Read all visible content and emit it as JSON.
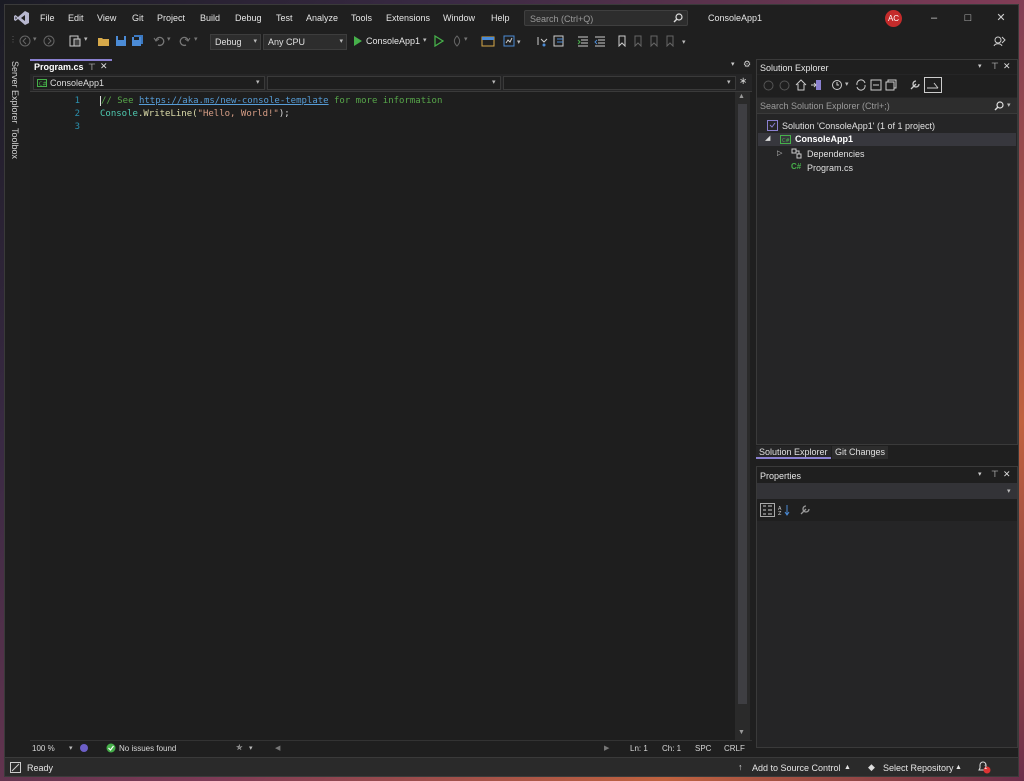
{
  "titlebar": {
    "menus": [
      "File",
      "Edit",
      "View",
      "Git",
      "Project",
      "Build",
      "Debug",
      "Test",
      "Analyze",
      "Tools",
      "Extensions",
      "Window",
      "Help"
    ],
    "search_placeholder": "Search (Ctrl+Q)",
    "app_title": "ConsoleApp1",
    "avatar_initials": "AC"
  },
  "toolbar": {
    "config": "Debug",
    "platform": "Any CPU",
    "run_target": "ConsoleApp1"
  },
  "sidetabs": [
    "Server Explorer",
    "Toolbox"
  ],
  "editor": {
    "tab_label": "Program.cs",
    "nav_project": "ConsoleApp1",
    "lines": [
      "1",
      "2",
      "3"
    ],
    "code": {
      "comment_prefix": "// See ",
      "link": "https://aka.ms/new-console-template",
      "comment_suffix": " for more information",
      "line2_class": "Console",
      "line2_method": ".WriteLine(",
      "line2_string": "\"Hello, World!\"",
      "line2_end": ");"
    },
    "status": {
      "zoom": "100 %",
      "issues": "No issues found",
      "ln": "Ln: 1",
      "ch": "Ch: 1",
      "spc": "SPC",
      "crlf": "CRLF"
    }
  },
  "solution_explorer": {
    "title": "Solution Explorer",
    "search_placeholder": "Search Solution Explorer (Ctrl+;)",
    "solution": "Solution 'ConsoleApp1' (1 of 1 project)",
    "project": "ConsoleApp1",
    "dependencies": "Dependencies",
    "file": "Program.cs"
  },
  "bottom_tabs": [
    "Solution Explorer",
    "Git Changes"
  ],
  "properties": {
    "title": "Properties"
  },
  "statusbar": {
    "ready": "Ready",
    "source_control": "Add to Source Control",
    "repository": "Select Repository",
    "notification_count": "1"
  },
  "colors": {
    "accent": "#8a80d0",
    "comment": "#57a64a",
    "link": "#569cd6",
    "string": "#d69d85",
    "class": "#4ec9b0",
    "linenumber": "#2b91af"
  }
}
